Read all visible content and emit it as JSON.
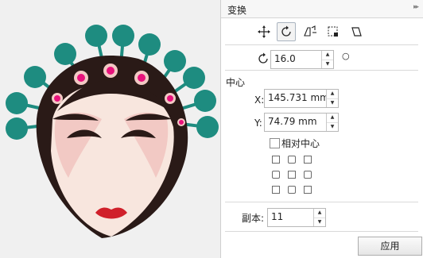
{
  "panel": {
    "title": "变换",
    "collapse_glyph": "▸▸",
    "tools": [
      {
        "name": "position-tool-icon",
        "active": false
      },
      {
        "name": "rotate-tool-icon",
        "active": true
      },
      {
        "name": "scale-mirror-tool-icon",
        "active": false
      },
      {
        "name": "size-tool-icon",
        "active": false
      },
      {
        "name": "skew-tool-icon",
        "active": false
      }
    ],
    "rotation": {
      "value": "16.0",
      "unit_symbol": "○"
    },
    "center": {
      "label": "中心",
      "x_label": "X:",
      "x_value": "145.731 mm",
      "y_label": "Y:",
      "y_value": "74.79 mm",
      "relative_label": "相对中心",
      "relative_checked": false
    },
    "copies": {
      "label": "副本:",
      "value": "11"
    },
    "apply_label": "应用"
  },
  "colors": {
    "teal": "#1e8c80",
    "dark": "#2a1a17",
    "pink": "#e8127c",
    "skin": "#f8e6de",
    "lip": "#d0202a"
  }
}
